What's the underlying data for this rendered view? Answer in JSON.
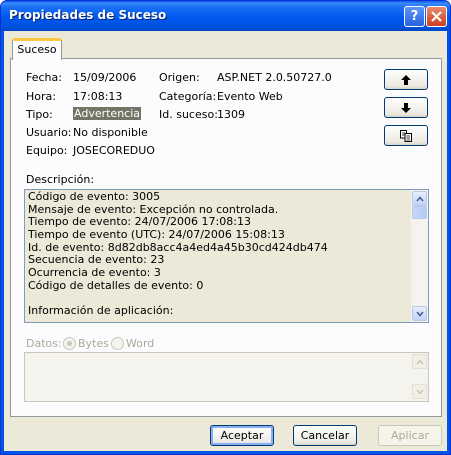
{
  "window": {
    "title": "Propiedades de Suceso",
    "help_glyph": "?"
  },
  "tab": {
    "label": "Suceso"
  },
  "fields": {
    "fecha": {
      "label": "Fecha:",
      "value": "15/09/2006"
    },
    "hora": {
      "label": "Hora:",
      "value": "17:08:13"
    },
    "tipo": {
      "label": "Tipo:",
      "value": "Advertencia"
    },
    "usuario": {
      "label": "Usuario:",
      "value": "No disponible"
    },
    "equipo": {
      "label": "Equipo:",
      "value": "JOSECOREDUO"
    },
    "origen": {
      "label": "Origen:",
      "value": "ASP.NET 2.0.50727.0"
    },
    "categoria": {
      "label": "Categoría:",
      "value": "Evento Web"
    },
    "id_suceso": {
      "label": "Id. suceso:",
      "value": "1309"
    }
  },
  "side_buttons": {
    "up_icon": "arrow-up-icon",
    "down_icon": "arrow-down-icon",
    "copy_icon": "copy-icon"
  },
  "description": {
    "label": "Descripción:",
    "lines": [
      "Código de evento: 3005",
      "Mensaje de evento: Excepción no controlada.",
      "Tiempo de evento: 24/07/2006 17:08:13",
      "Tiempo de evento (UTC): 24/07/2006 15:08:13",
      "Id. de evento: 8d82db8acc4a4ed4a45b30cd424db474",
      "Secuencia de evento: 23",
      "Ocurrencia de evento: 3",
      "Código de detalles de evento: 0",
      "",
      "Información de aplicación:"
    ]
  },
  "data": {
    "label": "Datos:",
    "options": [
      {
        "label": "Bytes",
        "selected": true
      },
      {
        "label": "Word",
        "selected": false
      }
    ]
  },
  "buttons": {
    "ok": "Aceptar",
    "cancel": "Cancelar",
    "apply": "Aplicar"
  },
  "colors": {
    "titlebar": "#0058ee",
    "dialog_bg": "#ece9d8",
    "tab_accent": "#ffc83c",
    "selection": "#747566"
  }
}
